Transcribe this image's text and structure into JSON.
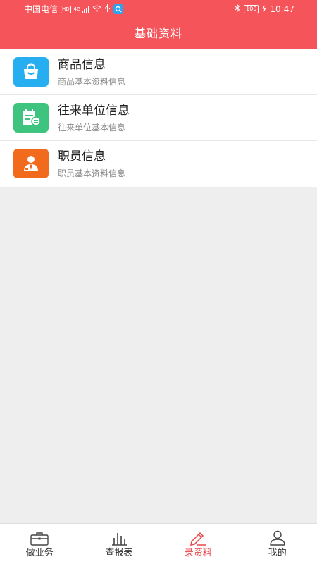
{
  "status_bar": {
    "carrier": "中国电信",
    "hd": "HD",
    "network": "4G",
    "battery": "100",
    "time": "10:47"
  },
  "header": {
    "title": "基础资料"
  },
  "colors": {
    "header_bg": "#f5545a",
    "tile_goods": "#27aef0",
    "tile_partner": "#3fc47f",
    "tile_staff": "#f26b1d",
    "tab_active": "#e8474c"
  },
  "menu": [
    {
      "title": "商品信息",
      "subtitle": "商品基本资料信息",
      "icon": "shopping-bag-icon"
    },
    {
      "title": "往来单位信息",
      "subtitle": "往来单位基本信息",
      "icon": "clipboard-icon"
    },
    {
      "title": "职员信息",
      "subtitle": "职员基本资料信息",
      "icon": "staff-person-icon"
    }
  ],
  "tabbar": {
    "active": "录资料",
    "tabs": [
      {
        "label": "做业务",
        "icon": "briefcase-icon"
      },
      {
        "label": "查报表",
        "icon": "bar-chart-icon"
      },
      {
        "label": "录资料",
        "icon": "pen-icon"
      },
      {
        "label": "我的",
        "icon": "user-icon"
      }
    ]
  }
}
